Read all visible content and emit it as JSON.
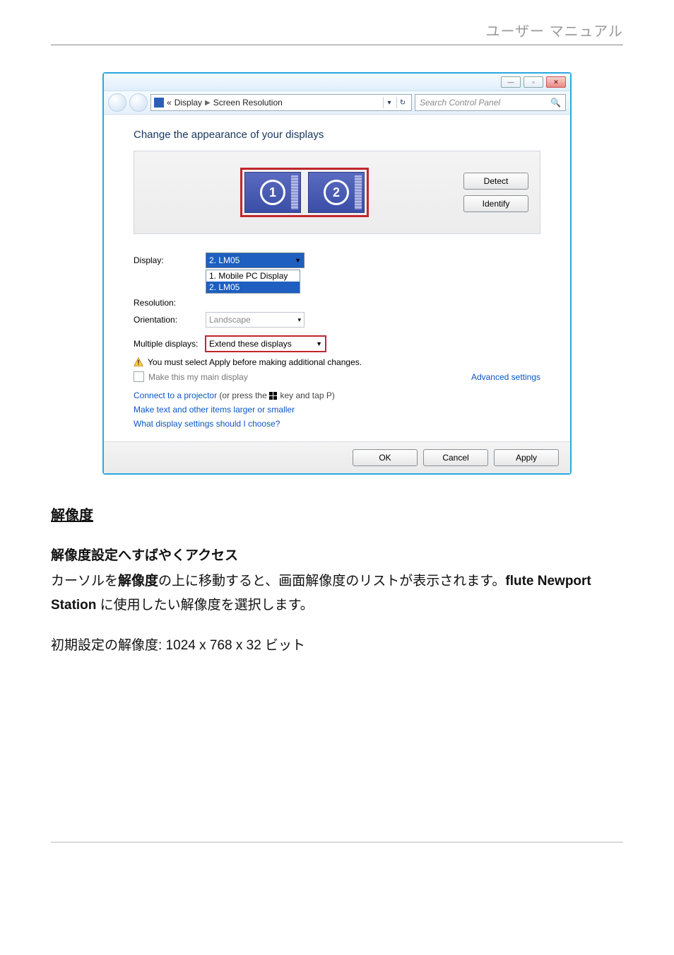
{
  "header": {
    "title": "ユーザー マニュアル"
  },
  "window": {
    "titlebar": {
      "min": "—",
      "max": "▫",
      "close": "✕"
    },
    "nav": {
      "breadcrumb_prefix": "«",
      "crumb1": "Display",
      "sep": "▶",
      "crumb2": "Screen Resolution",
      "dropdown_arrow": "▾",
      "refresh": "↻"
    },
    "search": {
      "placeholder": "Search Control Panel",
      "icon": "🔍"
    },
    "heading": "Change the appearance of your displays",
    "preview": {
      "monitor1": "1",
      "monitor2": "2",
      "detect": "Detect",
      "identify": "Identify"
    },
    "form": {
      "display_label": "Display:",
      "display_value": "2. LM05",
      "display_options": {
        "opt1": "1. Mobile PC Display",
        "opt2": "2. LM05"
      },
      "resolution_label": "Resolution:",
      "orientation_label": "Orientation:",
      "orientation_value": "Landscape",
      "multiple_label": "Multiple displays:",
      "multiple_value": "Extend these displays"
    },
    "warning": "You must select Apply before making additional changes.",
    "maindisp_label": "Make this my main display",
    "advanced": "Advanced settings",
    "links": {
      "projector_a": "Connect to a projector",
      "projector_b": " (or press the ",
      "projector_c": " key and tap P)",
      "textsize": "Make text and other items larger or smaller",
      "which": "What display settings should I choose?"
    },
    "buttons": {
      "ok": "OK",
      "cancel": "Cancel",
      "apply": "Apply"
    }
  },
  "doc": {
    "h": "解像度",
    "sub": "解像度設定へすばやくアクセス",
    "p1a": "カーソルを",
    "p1b": "解像度",
    "p1c": "の上に移動すると、画面解像度のリストが表示されます。",
    "p1d": "flute Newport Station",
    "p1e": " に使用したい解像度を選択します。",
    "p2": "初期設定の解像度: 1024 x 768 x 32 ビット"
  }
}
